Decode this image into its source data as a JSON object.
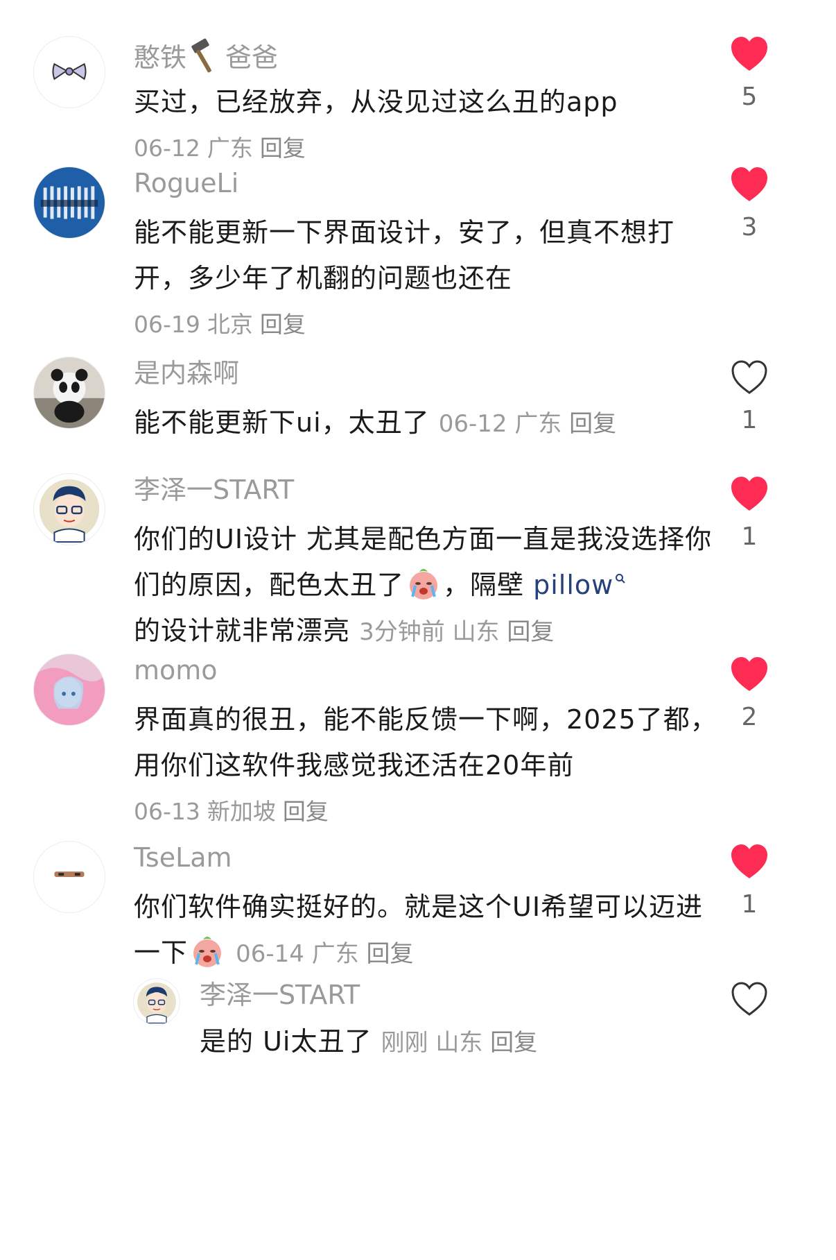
{
  "comments": [
    {
      "username": "憨铁",
      "username_suffix": "爸爸",
      "text": "买过，已经放弃，从没见过这么丑的app",
      "date": "06-12",
      "location": "广东",
      "reply_label": "回复",
      "likes": "5",
      "liked": true,
      "avatar_icon": "bow-icon"
    },
    {
      "username": "RogueLi",
      "text": "能不能更新一下界面设计，安了，但真不想打开，多少年了机翻的问题也还在",
      "date": "06-19",
      "location": "北京",
      "reply_label": "回复",
      "likes": "3",
      "liked": true,
      "avatar_icon": "blue-pattern-avatar"
    },
    {
      "username": "是内森啊",
      "text": "能不能更新下ui，太丑了",
      "date": "06-12",
      "location": "广东",
      "reply_label": "回复",
      "likes": "1",
      "liked": false,
      "avatar_icon": "panda-avatar"
    },
    {
      "username": "李泽一START",
      "text_part1": "你们的UI设计 尤其是配色方面一直是我没选择你们的原因，配色太丑了",
      "text_part2": "，隔壁 ",
      "link_text": "pillow",
      "text_part3": "的设计就非常漂亮",
      "date": "3分钟前",
      "location": "山东",
      "reply_label": "回复",
      "likes": "1",
      "liked": true,
      "avatar_icon": "cartoon-man-avatar"
    },
    {
      "username": "momo",
      "text": "界面真的很丑，能不能反馈一下啊，2025了都，用你们这软件我感觉我还活在20年前",
      "date": "06-13",
      "location": "新加坡",
      "reply_label": "回复",
      "likes": "2",
      "liked": true,
      "avatar_icon": "anime-girl-avatar"
    },
    {
      "username": "TseLam",
      "text": "你们软件确实挺好的。就是这个UI希望可以迈进一下",
      "date": "06-14",
      "location": "广东",
      "reply_label": "回复",
      "likes": "1",
      "liked": true,
      "avatar_icon": "face-avatar"
    }
  ],
  "reply": {
    "username": "李泽一START",
    "text": "是的 Ui太丑了",
    "date": "刚刚",
    "location": "山东",
    "reply_label": "回复",
    "liked": false,
    "avatar_icon": "cartoon-man-avatar"
  },
  "colors": {
    "heart_active": "#fe2c55",
    "meta_gray": "#9a9a9a",
    "link_blue": "#25407a"
  }
}
